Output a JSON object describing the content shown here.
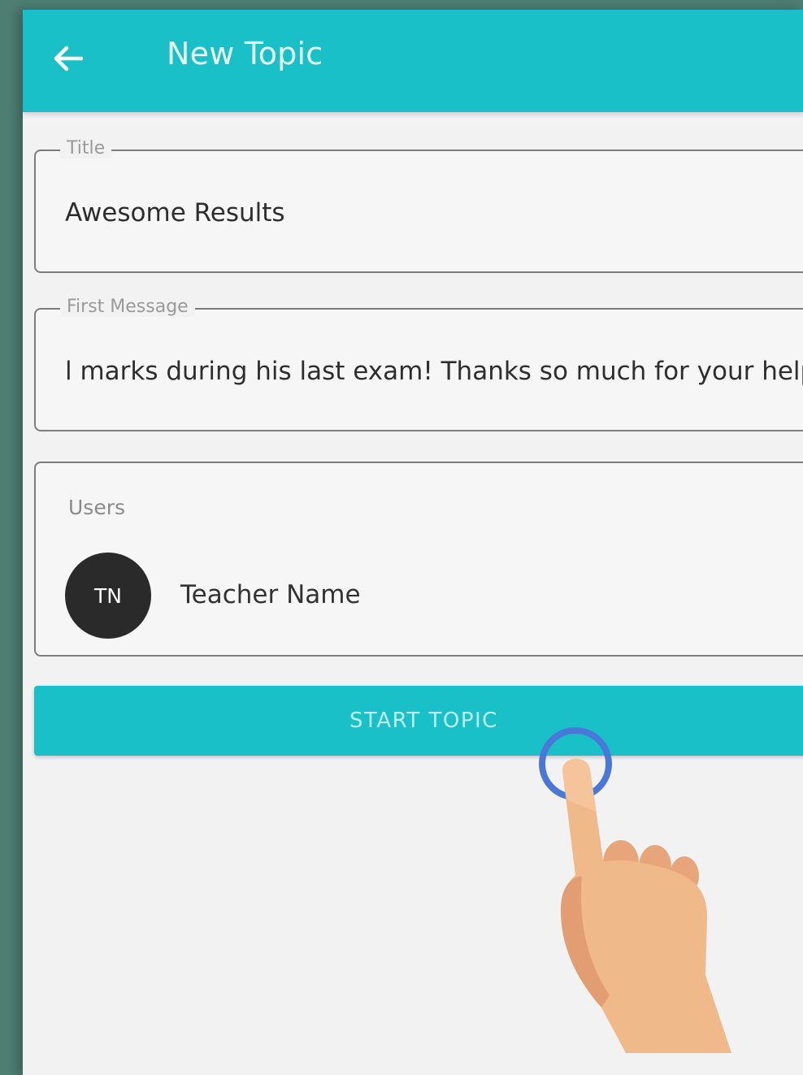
{
  "header": {
    "back_icon": "arrow-left-icon",
    "title": "New Topic"
  },
  "form": {
    "title_field": {
      "label": "Title",
      "value": "Awesome Results"
    },
    "message_field": {
      "label": "First Message",
      "value": "l marks during his last exam! Thanks so much for your help!"
    },
    "users": {
      "label": "Users",
      "items": [
        {
          "initials": "TN",
          "name": "Teacher Name"
        }
      ]
    },
    "submit_label": "START TOPIC"
  },
  "overlay": {
    "hand_icon": "pointing-hand-icon",
    "tap_indicator_icon": "tap-ring-icon"
  },
  "colors": {
    "accent": "#19c0c8",
    "background": "#f2f2f2",
    "avatar": "#2a2a2a",
    "tap_ring": "#4a78d8",
    "skin": "#f0b98a"
  }
}
